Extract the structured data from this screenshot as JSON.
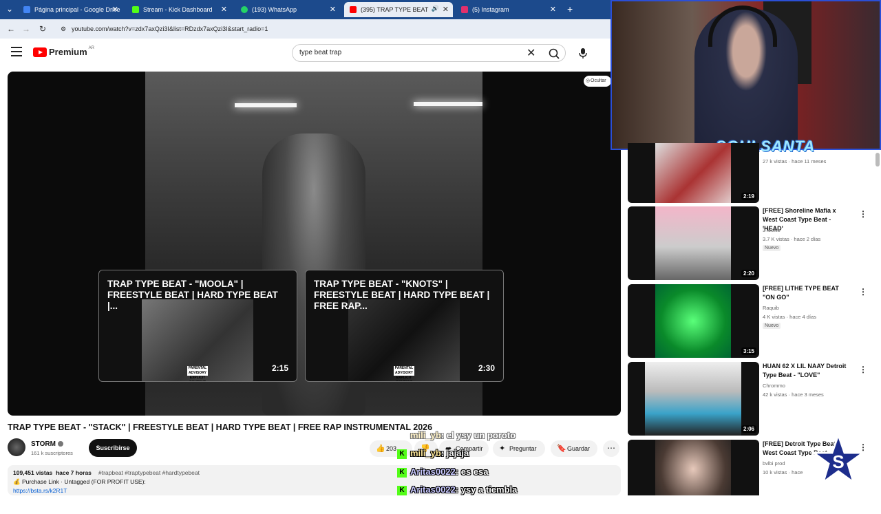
{
  "browser": {
    "tabs": [
      {
        "label": "Página principal - Google Drive",
        "color": "#4285f4"
      },
      {
        "label": "Stream - Kick Dashboard",
        "color": "#53fc18"
      },
      {
        "label": "(193) WhatsApp",
        "color": "#25d366"
      },
      {
        "label": "(395) TRAP TYPE BEAT - \"ST",
        "color": "#ff0000"
      },
      {
        "label": "(5) Instagram",
        "color": "#e1306c"
      }
    ],
    "url": "youtube.com/watch?v=zdx7axQzi3I&list=RDzdx7axQzi3I&start_radio=1"
  },
  "header": {
    "logo_text": "Premium",
    "logo_region": "AR",
    "search_value": "type beat trap"
  },
  "player": {
    "hide_label": "Ocultar",
    "endcards": [
      {
        "title": "TRAP TYPE BEAT - \"MOOLA\" | FREESTYLE BEAT | HARD TYPE BEAT |...",
        "duration": "2:15"
      },
      {
        "title": "TRAP TYPE BEAT - \"KNOTS\" | FREESTYLE BEAT | HARD TYPE BEAT | FREE RAP...",
        "duration": "2:30"
      }
    ],
    "parental_advisory": "PARENTAL ADVISORY EXPLICIT CONTENT"
  },
  "video": {
    "title": "TRAP TYPE BEAT - \"STACK\" | FREESTYLE BEAT | HARD TYPE BEAT | FREE RAP INSTRUMENTAL 2026",
    "channel": "STORM",
    "subscribers": "161 k suscriptores",
    "subscribe_label": "Suscribirse",
    "likes": "203",
    "share_label": "Compartir",
    "ask_label": "Preguntar",
    "save_label": "Guardar",
    "views": "109,451 vistas",
    "age": "hace 7 horas",
    "tags": "#trapbeat #traptypebeat #hardtypebeat",
    "purchase": "💰 Purchase Link · Untagged (FOR PROFIT USE):",
    "link": "https://bsta.rs/k2R1T"
  },
  "chat": [
    {
      "user": "mili_yb",
      "msg": ": el ysy un poroto"
    },
    {
      "user": "mili_yb",
      "msg": ": jajaja"
    },
    {
      "user": "Aritas0022",
      "msg": ": es esa"
    },
    {
      "user": "Aritas0022",
      "msg": ": ysy a tiembla"
    }
  ],
  "overlay": {
    "logo_text": "SOULSANTA"
  },
  "sidebar": [
    {
      "title": "",
      "channel": "",
      "meta": "27 k vistas · hace 11 meses",
      "badge": "",
      "duration": "2:19"
    },
    {
      "title": "[FREE] Shoreline Mafia x West Coast Type Beat - 'HEAD'",
      "channel": "3Tookie",
      "meta": "3.7 K vistas · hace 2 días",
      "badge": "Nuevo",
      "duration": "2:20"
    },
    {
      "title": "[FREE] LITHE TYPE BEAT \"ON GO\"",
      "channel": "Raquib",
      "meta": "4 K vistas · hace 4 días",
      "badge": "Nuevo",
      "duration": "3:15"
    },
    {
      "title": "HUAN 62 X LIL NAAY Detroit Type Beat - \"LOVE\"",
      "channel": "Chrommo",
      "meta": "42 k vistas · hace 3 meses",
      "badge": "",
      "duration": "2:06"
    },
    {
      "title": "[FREE] Detroit Type Beat x West Coast Type Beat - \"TI\"",
      "channel": "bvlbi prod",
      "meta": "10 k vistas · hace",
      "badge": "",
      "duration": ""
    }
  ],
  "colors": {
    "kick_green": "#53fc18",
    "youtube_red": "#ff0000",
    "tab_bar": "#1c4a8c"
  }
}
